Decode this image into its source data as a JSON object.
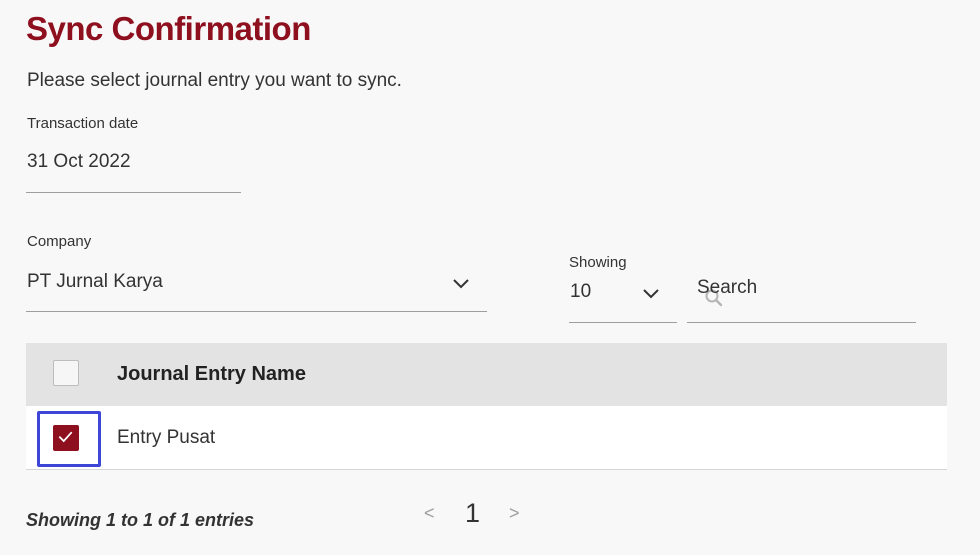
{
  "header": {
    "title": "Sync Confirmation",
    "subtitle": "Please select journal entry you want to sync."
  },
  "transaction_date": {
    "label": "Transaction date",
    "value": "31 Oct 2022"
  },
  "company": {
    "label": "Company",
    "value": "PT Jurnal Karya"
  },
  "showing": {
    "label": "Showing",
    "value": "10"
  },
  "search": {
    "placeholder": "Search"
  },
  "table": {
    "header": "Journal Entry Name",
    "rows": [
      {
        "name": "Entry Pusat",
        "checked": true
      }
    ]
  },
  "footer": {
    "info": "Showing 1 to 1 of 1 entries",
    "prev": "<",
    "page": "1",
    "next": ">"
  },
  "colors": {
    "accent": "#8e0f1e",
    "focus": "#3d46d6"
  }
}
